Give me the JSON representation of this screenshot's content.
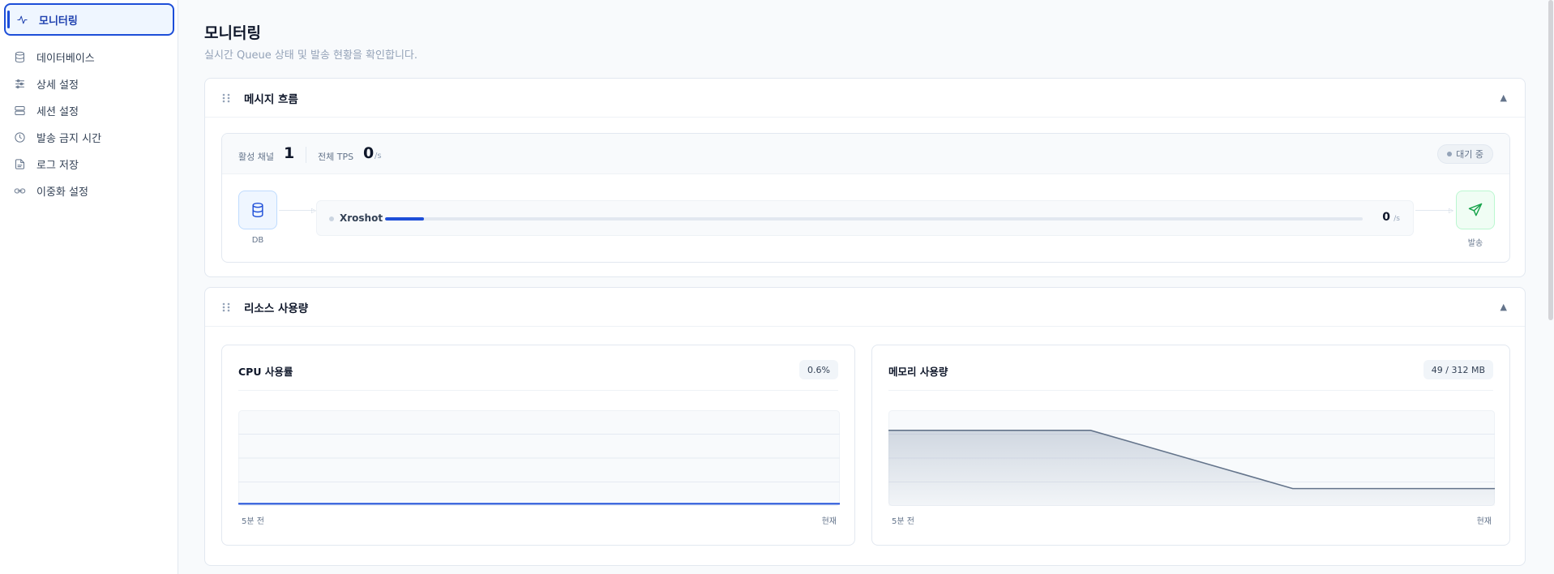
{
  "sidebar": {
    "items": [
      {
        "label": "모니터링",
        "icon": "activity-icon",
        "active": true
      },
      {
        "label": "데이터베이스",
        "icon": "database-icon"
      },
      {
        "label": "상세 설정",
        "icon": "sliders-icon"
      },
      {
        "label": "세션 설정",
        "icon": "server-icon"
      },
      {
        "label": "발송 금지 시간",
        "icon": "clock-icon"
      },
      {
        "label": "로그 저장",
        "icon": "file-icon"
      },
      {
        "label": "이중화 설정",
        "icon": "link-icon"
      }
    ]
  },
  "page": {
    "title": "모니터링",
    "subtitle": "실시간 Queue 상태 및 발송 현황을 확인합니다."
  },
  "flow": {
    "title": "메시지 흐름",
    "active_channels_label": "활성 채널",
    "active_channels_value": "1",
    "total_tps_label": "전체 TPS",
    "total_tps_value": "0",
    "tps_unit": "/s",
    "status": "대기 중",
    "source_label": "DB",
    "target_label": "발송",
    "channel": {
      "name": "Xroshot",
      "value": "0",
      "unit": "/s",
      "progress": 0.04
    }
  },
  "resources": {
    "title": "리소스 사용량",
    "cpu": {
      "title": "CPU 사용률",
      "badge": "0.6%",
      "start_label": "5분 전",
      "end_label": "현재"
    },
    "memory": {
      "title": "메모리 사용량",
      "badge": "49 / 312 MB",
      "start_label": "5분 전",
      "end_label": "현재"
    }
  },
  "colors": {
    "accent": "#1d4ed8",
    "success": "#16a34a",
    "memory_line": "#64748b"
  },
  "chart_data": [
    {
      "type": "line",
      "title": "CPU 사용률",
      "x": [
        0,
        1,
        2,
        3
      ],
      "series": [
        {
          "values": [
            0.6,
            0.6,
            0.6,
            0.6
          ]
        }
      ],
      "ylim": [
        0,
        100
      ],
      "xlabel": "",
      "ylabel": ""
    },
    {
      "type": "area",
      "title": "메모리 사용량",
      "x": [
        0,
        1,
        2,
        3
      ],
      "series": [
        {
          "values": [
            80,
            80,
            17,
            17
          ]
        }
      ],
      "ylim": [
        0,
        100
      ],
      "xlabel": "",
      "ylabel": ""
    }
  ]
}
